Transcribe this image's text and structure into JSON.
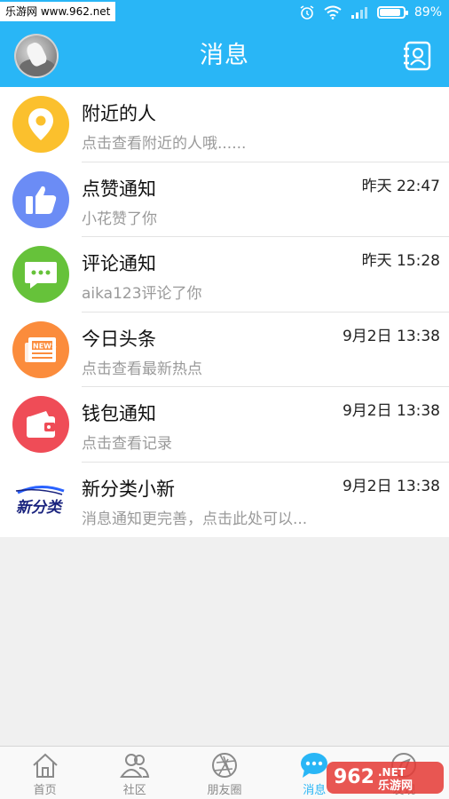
{
  "status_bar": {
    "watermark": "乐游网 www.962.net",
    "battery": "89%",
    "battery_level": 0.89
  },
  "header": {
    "title": "消息"
  },
  "messages": [
    {
      "name": "附近的人",
      "subtitle": "点击查看附近的人哦......",
      "time": "",
      "color": "#fbc02d",
      "icon": "location-pin-icon"
    },
    {
      "name": "点赞通知",
      "subtitle": "小花赞了你",
      "time": "昨天 22:47",
      "color": "#6b8cf5",
      "icon": "thumbs-up-icon"
    },
    {
      "name": "评论通知",
      "subtitle": "aika123评论了你",
      "time": "昨天 15:28",
      "color": "#66c23a",
      "icon": "chat-bubble-icon"
    },
    {
      "name": "今日头条",
      "subtitle": "点击查看最新热点",
      "time": "9月2日 13:38",
      "color": "#fb8c3c",
      "icon": "newspaper-icon"
    },
    {
      "name": "钱包通知",
      "subtitle": "点击查看记录",
      "time": "9月2日 13:38",
      "color": "#ef4c57",
      "icon": "wallet-icon"
    },
    {
      "name": "新分类小新",
      "subtitle": "消息通知更完善，点击此处可以...",
      "time": "9月2日 13:38",
      "color": "#1a237e",
      "icon": "brand-logo-icon",
      "logo_text": "新分类"
    }
  ],
  "bottom_nav": {
    "tabs": [
      {
        "label": "首页",
        "icon": "home-icon",
        "active": false
      },
      {
        "label": "社区",
        "icon": "community-icon",
        "active": false
      },
      {
        "label": "朋友圈",
        "icon": "aperture-icon",
        "active": false
      },
      {
        "label": "消息",
        "icon": "message-icon",
        "active": true
      },
      {
        "label": "发现",
        "icon": "discover-icon",
        "active": false
      }
    ],
    "watermark": "962.NET 乐游网"
  },
  "colors": {
    "accent": "#29b6f6",
    "background": "#f0f0f0"
  }
}
